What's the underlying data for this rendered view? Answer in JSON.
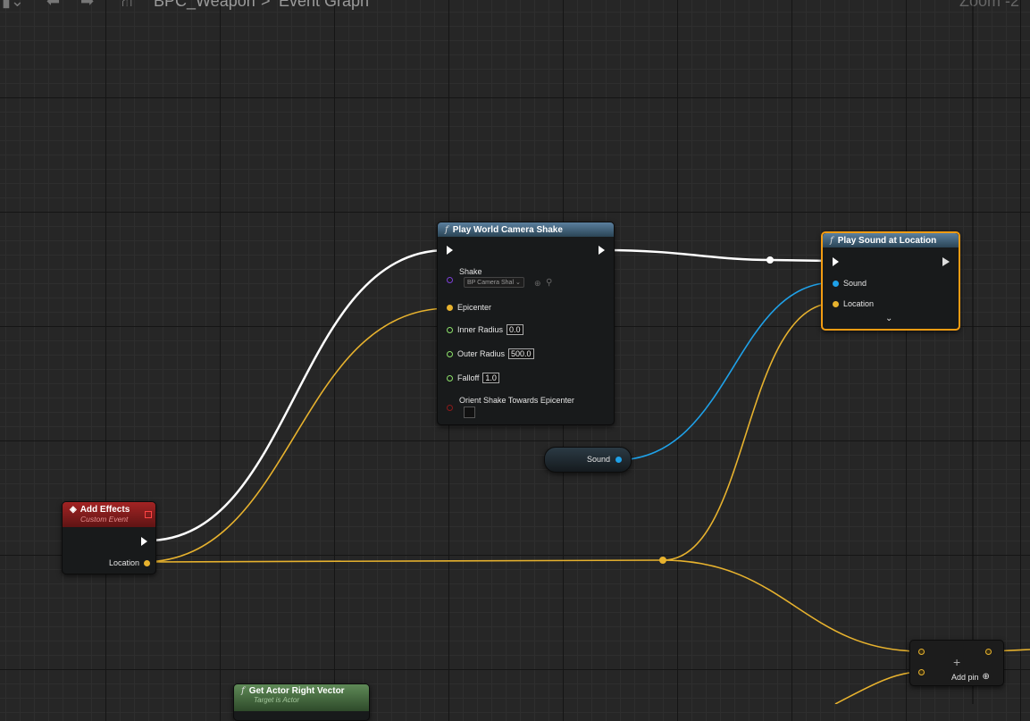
{
  "header": {
    "breadcrumb_blueprint": "BPC_Weapon",
    "breadcrumb_separator": ">",
    "breadcrumb_graph": "Event Graph",
    "zoom": "Zoom -2"
  },
  "nodes": {
    "add_effects": {
      "title": "Add Effects",
      "subtitle": "Custom Event",
      "pin_location": "Location"
    },
    "camera_shake": {
      "title": "Play World Camera Shake",
      "pin_shake": "Shake",
      "shake_value": "BP Camera Shal",
      "pin_epicenter": "Epicenter",
      "pin_inner_radius": "Inner Radius",
      "inner_radius_value": "0.0",
      "pin_outer_radius": "Outer Radius",
      "outer_radius_value": "500.0",
      "pin_falloff": "Falloff",
      "falloff_value": "1.0",
      "pin_orient": "Orient Shake Towards Epicenter"
    },
    "play_sound": {
      "title": "Play Sound at Location",
      "pin_sound": "Sound",
      "pin_location": "Location"
    },
    "sound_var": {
      "label": "Sound"
    },
    "make_node": {
      "add_pin": "Add pin",
      "plus": "+"
    },
    "get_right_vector": {
      "title": "Get Actor Right Vector",
      "subtitle": "Target is Actor"
    }
  },
  "colors": {
    "exec_wire": "#ffffff",
    "vector_pin": "#f5c542",
    "object_pin": "#1fa1e8",
    "float_pin": "#8de06a",
    "bool_pin": "#8b1a1a",
    "class_pin": "#7b3fd6",
    "event_header": "#8e1d1d",
    "function_header": "#3b5f7a",
    "pure_header": "#3e6b3a",
    "selection": "#f39c12"
  }
}
